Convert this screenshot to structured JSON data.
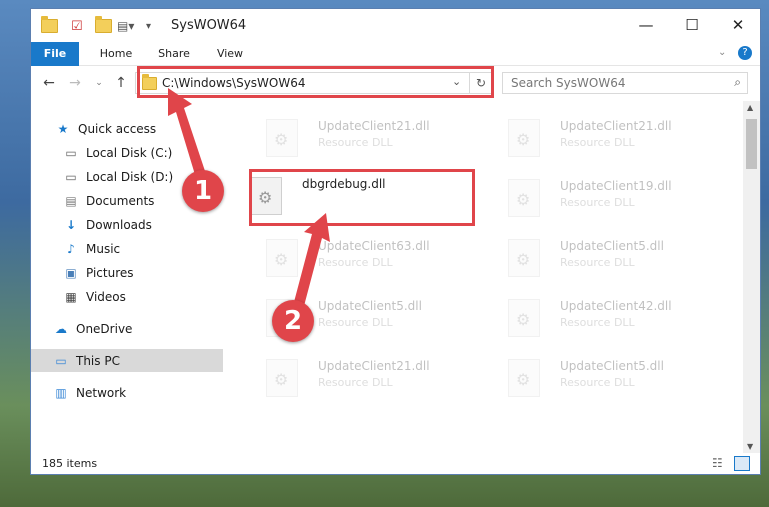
{
  "window": {
    "title": "SysWOW64"
  },
  "ribbon": {
    "tabs": [
      "File",
      "Home",
      "Share",
      "View"
    ]
  },
  "address": {
    "path": "C:\\Windows\\SysWOW64",
    "search_placeholder": "Search SysWOW64"
  },
  "nav": {
    "items": [
      {
        "label": "Quick access",
        "icon": "star-icon"
      },
      {
        "label": "Local Disk (C:)",
        "icon": "drive-icon"
      },
      {
        "label": "Local Disk (D:)",
        "icon": "drive-icon"
      },
      {
        "label": "Documents",
        "icon": "documents-icon"
      },
      {
        "label": "Downloads",
        "icon": "download-icon"
      },
      {
        "label": "Music",
        "icon": "music-icon"
      },
      {
        "label": "Pictures",
        "icon": "pictures-icon"
      },
      {
        "label": "Videos",
        "icon": "videos-icon"
      },
      {
        "label": "OneDrive",
        "icon": "cloud-icon"
      },
      {
        "label": "This PC",
        "icon": "computer-icon"
      },
      {
        "label": "Network",
        "icon": "network-icon"
      }
    ]
  },
  "files": {
    "left": [
      {
        "name": "UpdateClient21.dll",
        "type": "Resource DLL"
      },
      {
        "name": "dbgrdebug.dll",
        "type": ""
      },
      {
        "name": "UpdateClient63.dll",
        "type": "Resource DLL"
      },
      {
        "name": "UpdateClient5.dll",
        "type": "Resource DLL"
      },
      {
        "name": "UpdateClient21.dll",
        "type": "Resource DLL"
      }
    ],
    "right": [
      {
        "name": "UpdateClient21.dll",
        "type": "Resource DLL"
      },
      {
        "name": "UpdateClient19.dll",
        "type": "Resource DLL"
      },
      {
        "name": "UpdateClient5.dll",
        "type": "Resource DLL"
      },
      {
        "name": "UpdateClient42.dll",
        "type": "Resource DLL"
      },
      {
        "name": "UpdateClient5.dll",
        "type": "Resource DLL"
      }
    ]
  },
  "status": {
    "count": "185 items"
  },
  "callouts": [
    "1",
    "2"
  ],
  "colors": {
    "accent": "#1979ca",
    "highlight": "#e0454a"
  }
}
